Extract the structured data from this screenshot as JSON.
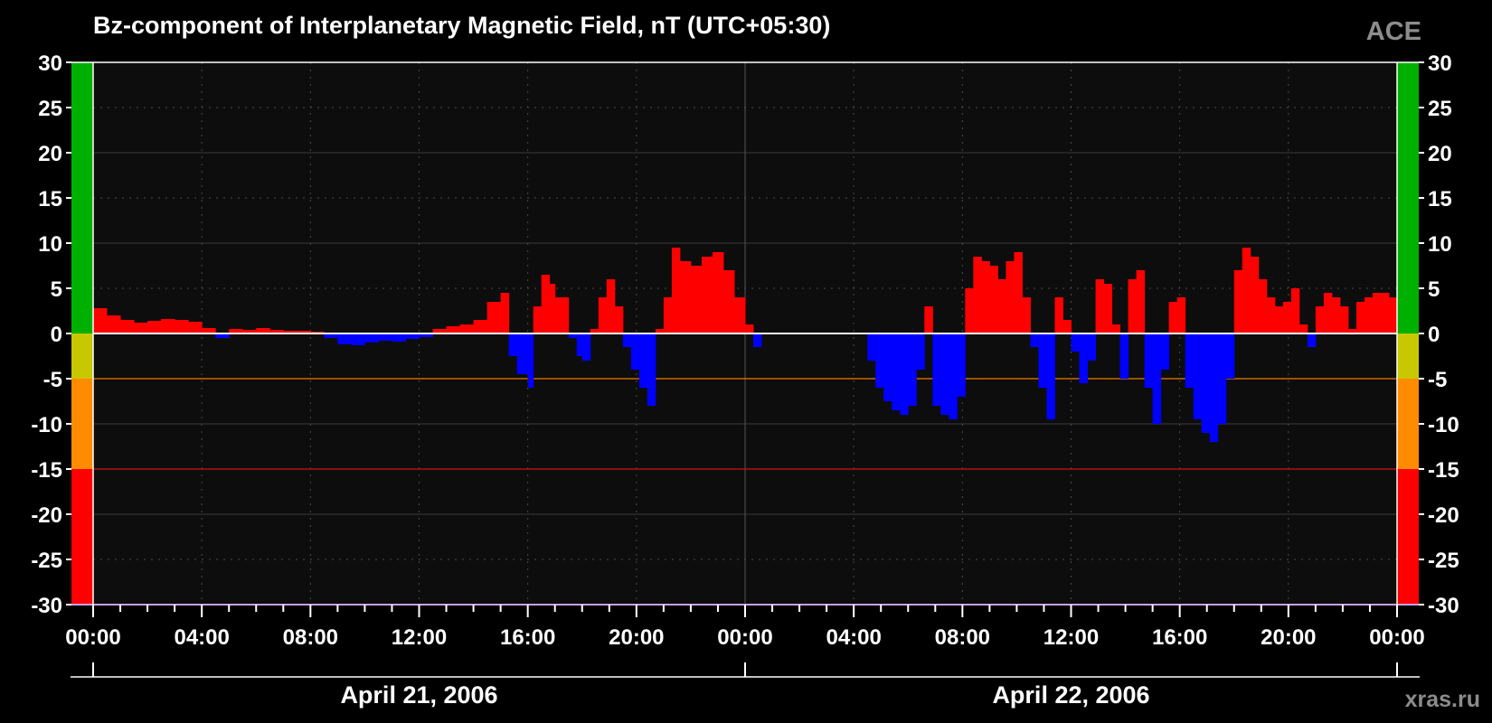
{
  "chart_data": {
    "type": "bar",
    "title": "Bz-component of Interplanetary Magnetic Field, nT (UTC+05:30)",
    "source_label": "ACE",
    "site_label": "xras.ru",
    "xlabel": "",
    "ylabel": "",
    "ylim": [
      -30,
      30
    ],
    "yticks": [
      "30",
      "25",
      "20",
      "15",
      "10",
      "5",
      "0",
      "-5",
      "-10",
      "-15",
      "-20",
      "-25",
      "-30"
    ],
    "xlim_hours": [
      0,
      48
    ],
    "xticks": [
      "00:00",
      "04:00",
      "08:00",
      "12:00",
      "16:00",
      "20:00",
      "00:00",
      "04:00",
      "08:00",
      "12:00",
      "16:00",
      "20:00",
      "00:00"
    ],
    "dates": [
      "April 21, 2006",
      "April 22, 2006"
    ],
    "grid": true,
    "positive_color": "#ff0000",
    "negative_color": "#0000ff",
    "background_color": "#0d0d0d",
    "threshold_lines": [
      {
        "value": -5,
        "color": "#c86a00"
      },
      {
        "value": -15,
        "color": "#b01010"
      }
    ],
    "scale_bands": [
      {
        "from": 0,
        "to": 30,
        "color": "#00b000"
      },
      {
        "from": -5,
        "to": 0,
        "color": "#c8c800"
      },
      {
        "from": -15,
        "to": -5,
        "color": "#ff8c00"
      },
      {
        "from": -30,
        "to": -15,
        "color": "#ff0000"
      }
    ],
    "series": [
      {
        "x_hours": [
          0.0,
          0.5,
          1.0,
          1.5,
          2.0,
          2.5,
          3.0,
          3.5,
          4.0,
          4.5,
          5.0,
          5.5,
          6.0,
          6.5,
          7.0,
          7.5,
          8.0,
          8.5,
          9.0,
          9.5,
          10.0,
          10.5,
          11.0,
          11.5,
          12.0,
          12.5,
          13.0,
          13.5,
          14.0,
          14.5,
          15.0,
          15.3,
          15.6,
          16.0,
          16.2,
          16.5,
          16.8,
          17.0,
          17.5,
          17.8,
          18.0,
          18.3,
          18.6,
          18.9,
          19.2,
          19.5,
          19.8,
          20.1,
          20.4,
          20.7,
          21.0,
          21.3,
          21.6,
          22.0,
          22.4,
          22.8,
          23.2,
          23.6,
          24.0,
          24.3,
          24.6,
          25.0,
          26.0,
          27.0,
          28.0,
          28.5,
          28.8,
          29.1,
          29.4,
          29.7,
          30.0,
          30.3,
          30.6,
          30.9,
          31.2,
          31.5,
          31.8,
          32.1,
          32.4,
          32.7,
          33.0,
          33.3,
          33.6,
          33.9,
          34.2,
          34.5,
          34.8,
          35.1,
          35.4,
          35.7,
          36.0,
          36.3,
          36.6,
          36.9,
          37.2,
          37.5,
          37.8,
          38.1,
          38.4,
          38.7,
          39.0,
          39.3,
          39.6,
          39.9,
          40.2,
          40.5,
          40.8,
          41.1,
          41.4,
          41.7,
          42.0,
          42.3,
          42.6,
          42.9,
          43.2,
          43.5,
          43.8,
          44.1,
          44.4,
          44.7,
          45.0,
          45.3,
          45.6,
          45.9,
          46.2,
          46.5,
          46.8,
          47.1,
          47.4,
          47.7
        ],
        "values": [
          2.8,
          2.0,
          1.5,
          1.2,
          1.4,
          1.6,
          1.5,
          1.3,
          0.6,
          -0.5,
          0.5,
          0.4,
          0.6,
          0.4,
          0.3,
          0.3,
          0.2,
          -0.5,
          -1.2,
          -1.3,
          -1.0,
          -0.8,
          -0.9,
          -0.6,
          -0.4,
          0.5,
          0.8,
          1.0,
          1.5,
          3.5,
          4.5,
          -2.5,
          -4.5,
          -6.0,
          3.0,
          6.5,
          5.5,
          4.0,
          -0.5,
          -2.5,
          -3.0,
          0.5,
          4.0,
          6.0,
          3.0,
          -1.5,
          -4.0,
          -6.0,
          -8.0,
          0.5,
          4.0,
          9.5,
          8.0,
          7.5,
          8.5,
          9.0,
          7.0,
          4.0,
          1.0,
          -1.5,
          0.0,
          0.0,
          0.0,
          0.0,
          0.0,
          -3.0,
          -6.0,
          -7.5,
          -8.5,
          -9.0,
          -8.0,
          -4.0,
          3.0,
          -8.0,
          -9.0,
          -9.5,
          -7.0,
          5.0,
          8.5,
          8.0,
          7.5,
          6.0,
          8.0,
          9.0,
          4.0,
          -1.5,
          -6.0,
          -9.5,
          4.0,
          1.5,
          -2.0,
          -5.5,
          -3.0,
          6.0,
          5.5,
          1.0,
          -5.0,
          6.0,
          7.0,
          -6.0,
          -10.0,
          -4.0,
          3.5,
          4.0,
          -6.0,
          -9.5,
          -11.0,
          -12.0,
          -10.0,
          -5.0,
          7.0,
          9.5,
          8.5,
          6.0,
          4.0,
          3.0,
          3.5,
          5.0,
          1.0,
          -1.5,
          3.0,
          4.5,
          4.0,
          3.0,
          0.5,
          3.5,
          4.0,
          4.5,
          4.5,
          4.0
        ]
      }
    ]
  }
}
